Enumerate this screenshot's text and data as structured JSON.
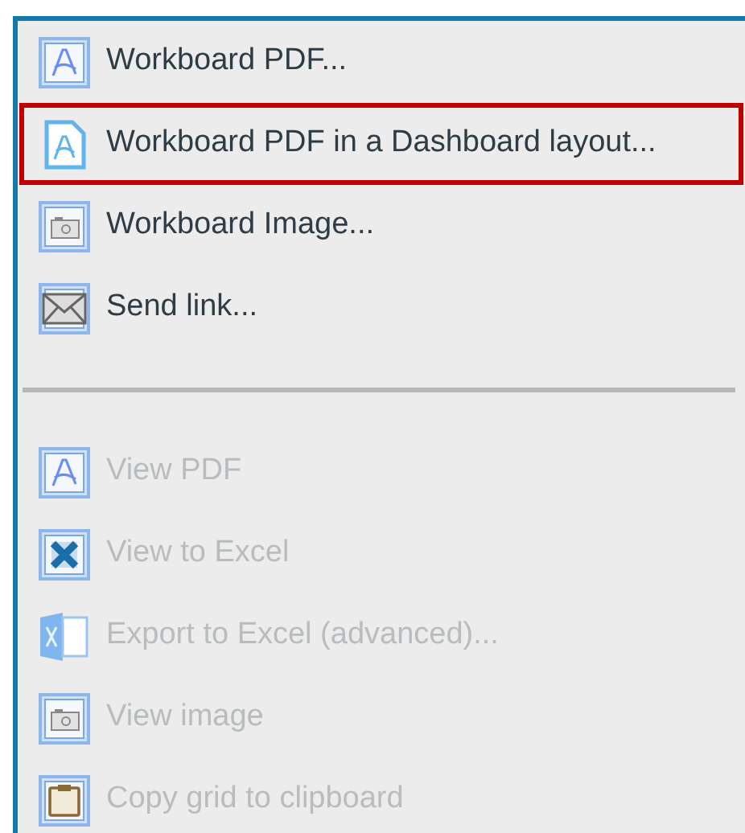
{
  "groups": [
    {
      "items": [
        {
          "kind": "pdf",
          "label": "Workboard PDF...",
          "disabled": false,
          "highlighted": false
        },
        {
          "kind": "pdf-doc",
          "label": "Workboard PDF in a Dashboard layout...",
          "disabled": false,
          "highlighted": true
        },
        {
          "kind": "image",
          "label": "Workboard Image...",
          "disabled": false,
          "highlighted": false
        },
        {
          "kind": "mail",
          "label": "Send link...",
          "disabled": false,
          "highlighted": false
        }
      ]
    },
    {
      "items": [
        {
          "kind": "pdf",
          "label": "View PDF",
          "disabled": true,
          "highlighted": false
        },
        {
          "kind": "excel",
          "label": "View to Excel",
          "disabled": true,
          "highlighted": false
        },
        {
          "kind": "excel-app",
          "label": "Export to Excel (advanced)...",
          "disabled": true,
          "highlighted": false
        },
        {
          "kind": "image",
          "label": "View image",
          "disabled": true,
          "highlighted": false
        },
        {
          "kind": "clipboard",
          "label": "Copy grid to clipboard",
          "disabled": true,
          "highlighted": false
        }
      ]
    }
  ]
}
